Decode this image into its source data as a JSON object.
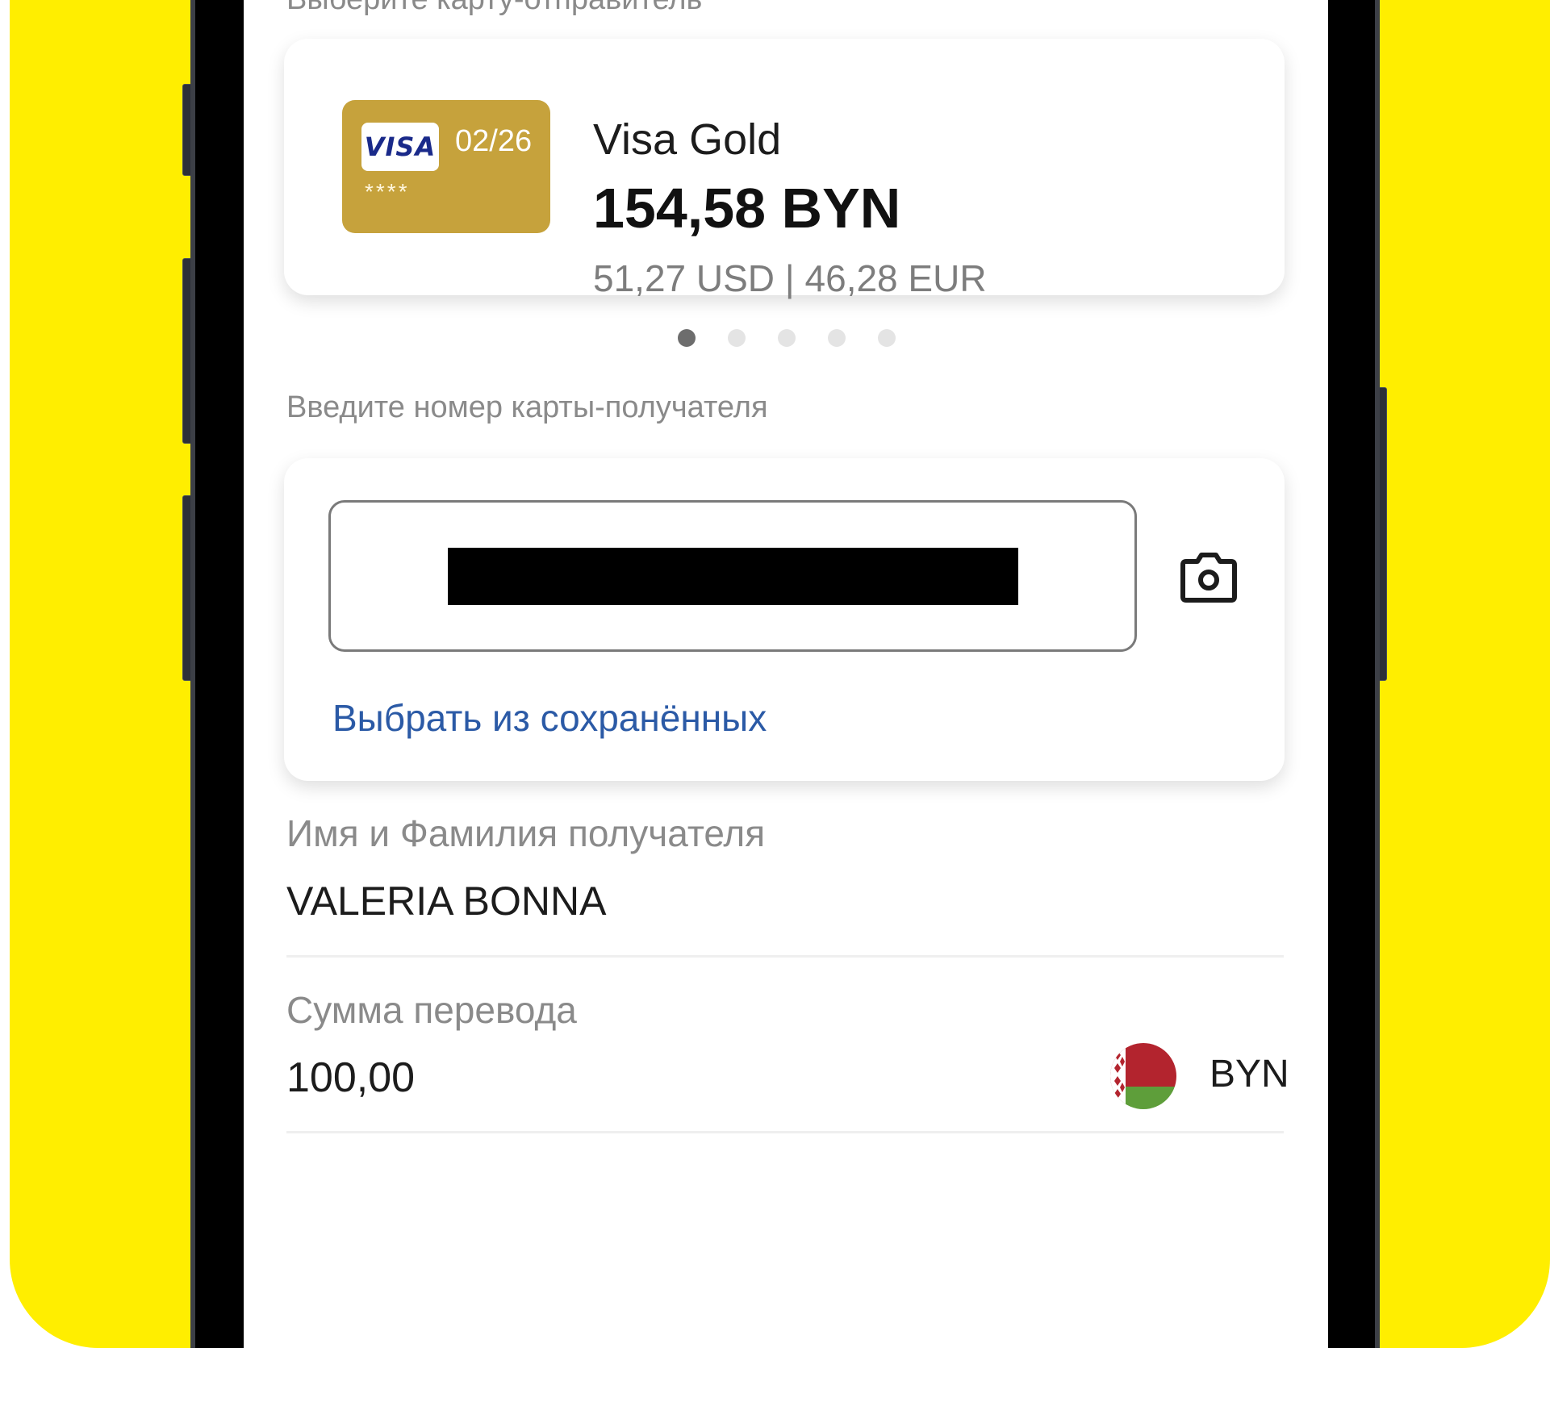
{
  "page": {
    "top_label": "Выберите карту-отправитель"
  },
  "sender_card": {
    "brand": "VISA",
    "expiry": "02/26",
    "masked_number": "****",
    "name": "Visa Gold",
    "balance": "154,58 BYN",
    "conversions": "51,27 USD | 46,28 EUR",
    "card_color": "#C6A23C"
  },
  "carousel": {
    "total": 5,
    "active_index": 0
  },
  "recipient": {
    "label": "Введите номер карты-получателя",
    "saved_link": "Выбрать из сохранённых",
    "camera_icon": "camera-icon"
  },
  "name_field": {
    "label": "Имя и Фамилия получателя",
    "value": "VALERIA BONNA"
  },
  "amount_field": {
    "label": "Сумма перевода",
    "value": "100,00",
    "currency": "BYN",
    "flag_icon": "belarus-flag-icon"
  },
  "colors": {
    "background_accent": "#FFEE00",
    "link": "#2B5AA6",
    "flag_red": "#B3242E",
    "flag_green": "#5E9E3A"
  }
}
